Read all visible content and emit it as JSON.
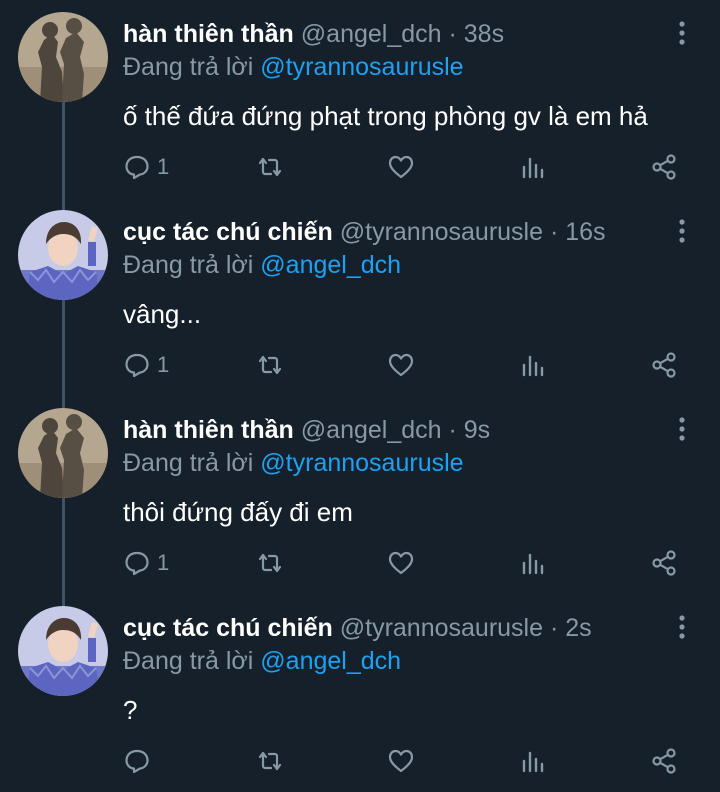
{
  "colors": {
    "background": "#15202b",
    "name": "#ffffff",
    "muted": "#8899a6",
    "mention": "#1da1f2",
    "thread_line": "#3d5466"
  },
  "reply_prefix": "Đang trả lời",
  "tweets": [
    {
      "name": "hàn thiên thần",
      "handle": "@angel_dch",
      "time": "· 38s",
      "reply_to": "@tyrannosaurusle",
      "text": "ố thế đứa đứng phạt trong phòng gv là em hả",
      "reply_count": "1",
      "avatar": "shadow-photo"
    },
    {
      "name": "cục tác chú chiến",
      "handle": "@tyrannosaurusle",
      "time": "· 16s",
      "reply_to": "@angel_dch",
      "text": "vâng...",
      "reply_count": "1",
      "avatar": "person-photo"
    },
    {
      "name": "hàn thiên thần",
      "handle": "@angel_dch",
      "time": "· 9s",
      "reply_to": "@tyrannosaurusle",
      "text": "thôi đứng đấy đi em",
      "reply_count": "1",
      "avatar": "shadow-photo"
    },
    {
      "name": "cục tác chú chiến",
      "handle": "@tyrannosaurusle",
      "time": "· 2s",
      "reply_to": "@angel_dch",
      "text": "?",
      "reply_count": "",
      "avatar": "person-photo"
    }
  ],
  "icons": [
    "reply-icon",
    "retweet-icon",
    "like-icon",
    "analytics-icon",
    "share-icon",
    "more-icon"
  ]
}
